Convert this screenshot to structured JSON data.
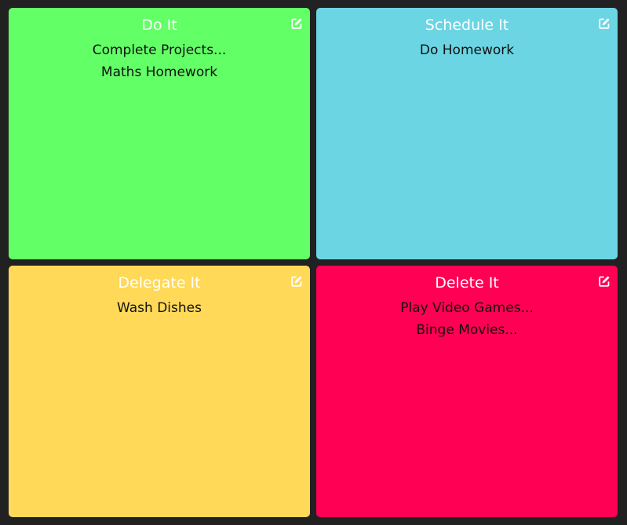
{
  "quadrants": [
    {
      "title": "Do It",
      "color": "#62ff66",
      "edit_icon": "edit-icon",
      "tasks": [
        "Complete Projects...",
        "Maths Homework"
      ]
    },
    {
      "title": "Schedule It",
      "color": "#6bd5e3",
      "edit_icon": "edit-icon",
      "tasks": [
        "Do Homework"
      ]
    },
    {
      "title": "Delegate It",
      "color": "#ffd957",
      "edit_icon": "edit-icon",
      "tasks": [
        "Wash Dishes"
      ]
    },
    {
      "title": "Delete It",
      "color": "#ff0054",
      "edit_icon": "edit-icon",
      "tasks": [
        "Play Video Games...",
        "Binge Movies..."
      ]
    }
  ]
}
